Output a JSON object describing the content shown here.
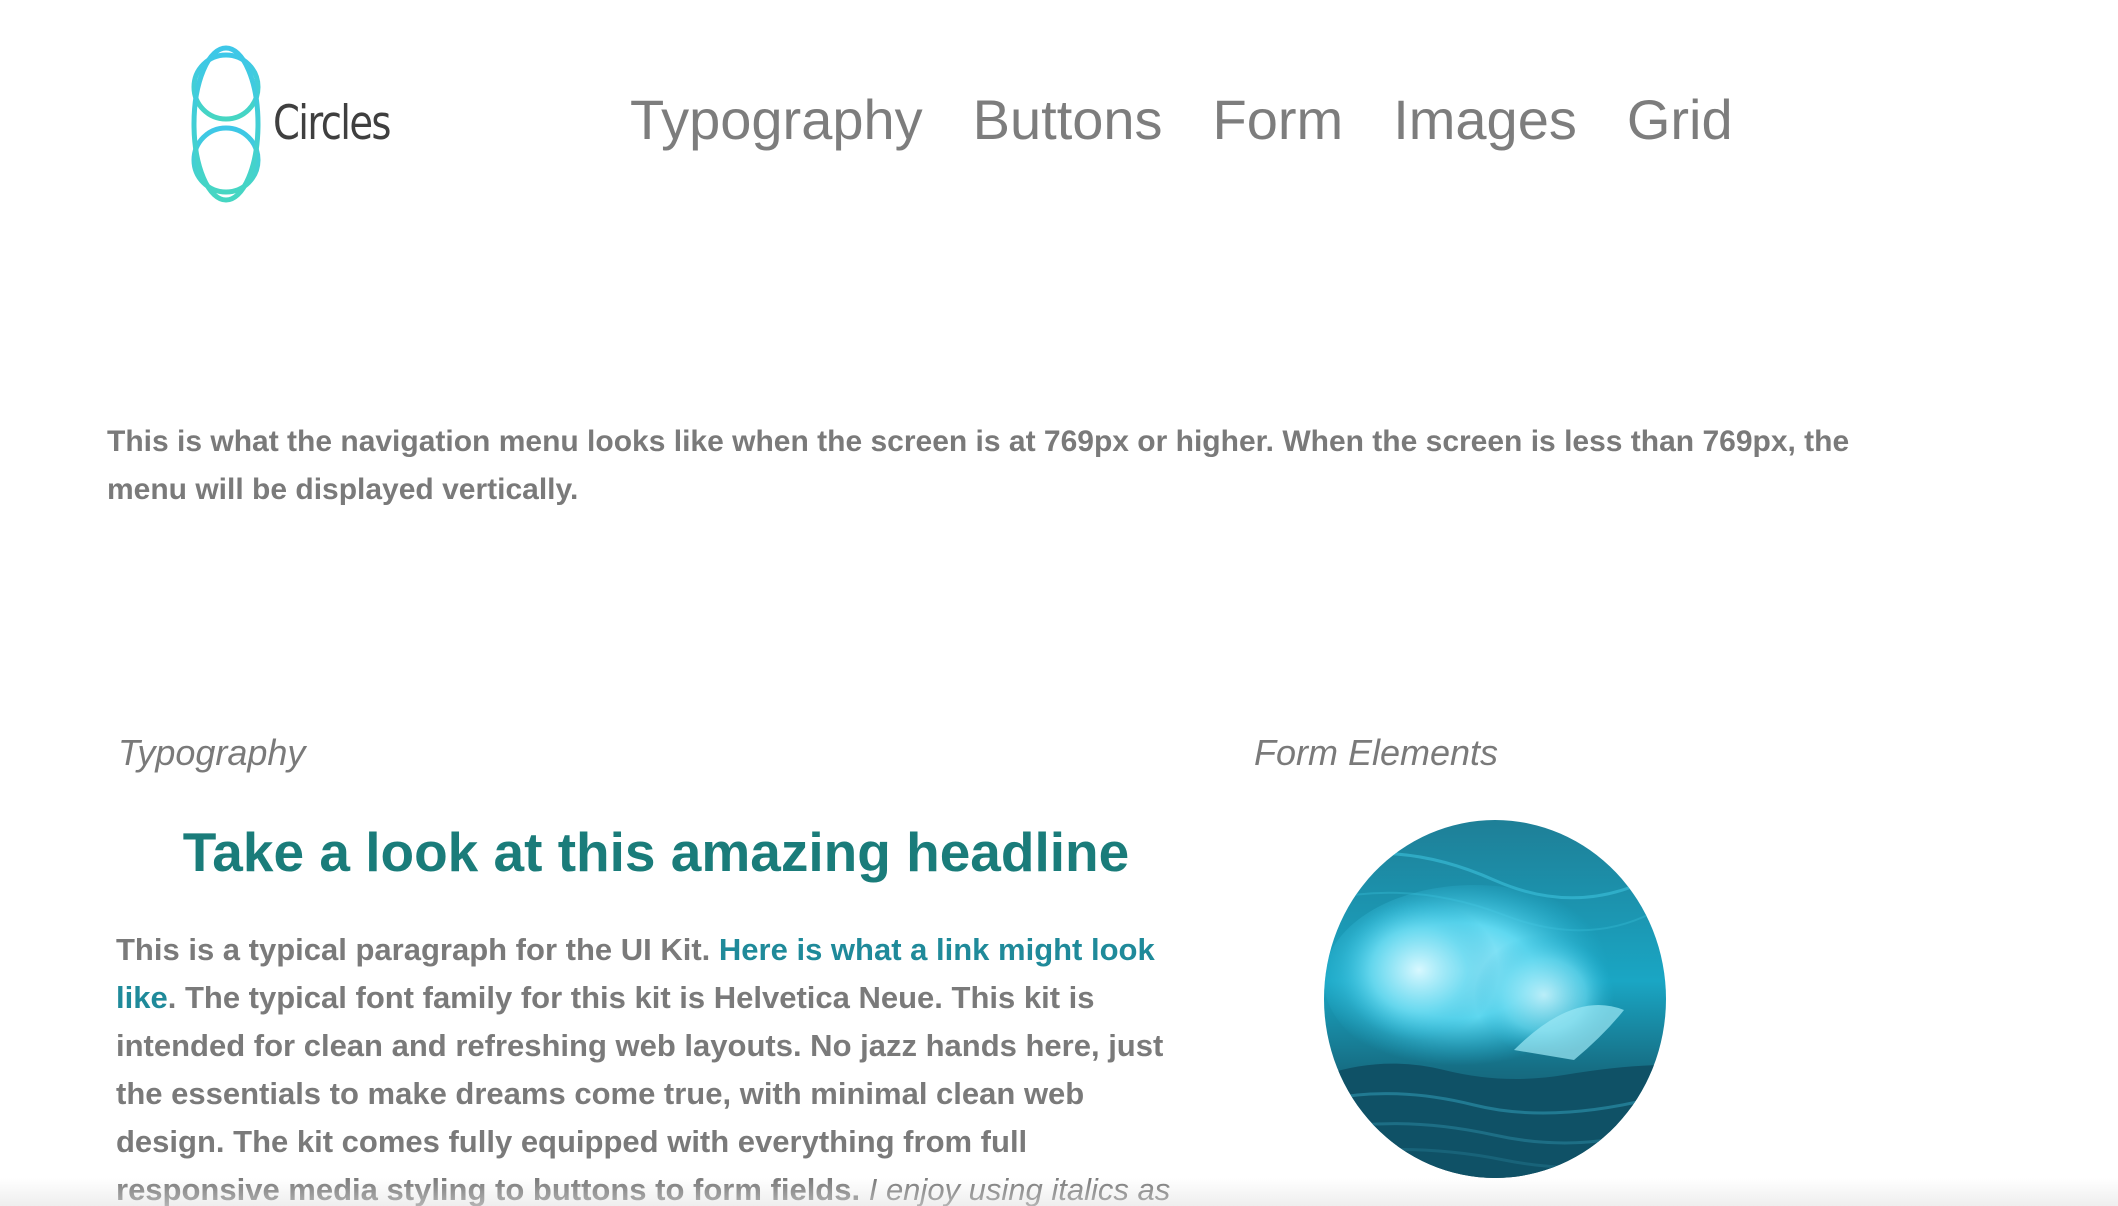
{
  "logo": {
    "text": "Circles",
    "icon": "overlapping-circles-icon",
    "colors": [
      "#3ec7e8",
      "#46d6c2"
    ]
  },
  "nav": {
    "items": [
      "Typography",
      "Buttons",
      "Form",
      "Images",
      "Grid"
    ]
  },
  "intro": {
    "text": "This is what the navigation menu looks like when the screen is at 769px or higher. When the screen is less than 769px, the menu will be displayed vertically."
  },
  "typography": {
    "section_label": "Typography",
    "headline": "Take a look at this amazing headline",
    "paragraph_before_link": "This is a typical paragraph for the UI Kit. ",
    "link_text": "Here is what a link might look like",
    "paragraph_after_link": ". The typical font family for this kit is Helvetica Neue. This kit is intended for clean and refreshing web layouts. No jazz hands here, just the essentials to make dreams come true, with minimal clean web design. The kit comes fully equipped with everything from full responsive media styling to buttons to form fields. ",
    "italic_text": "I enjoy using italics as"
  },
  "form_elements": {
    "section_label": "Form Elements",
    "image": "ocean-wave-image"
  },
  "colors": {
    "headline": "#1a7c7a",
    "link": "#1f8a9a",
    "body_text": "#7a7a7a",
    "nav_text": "#7d7d7d",
    "wave_tint": "#2fc4e0"
  }
}
